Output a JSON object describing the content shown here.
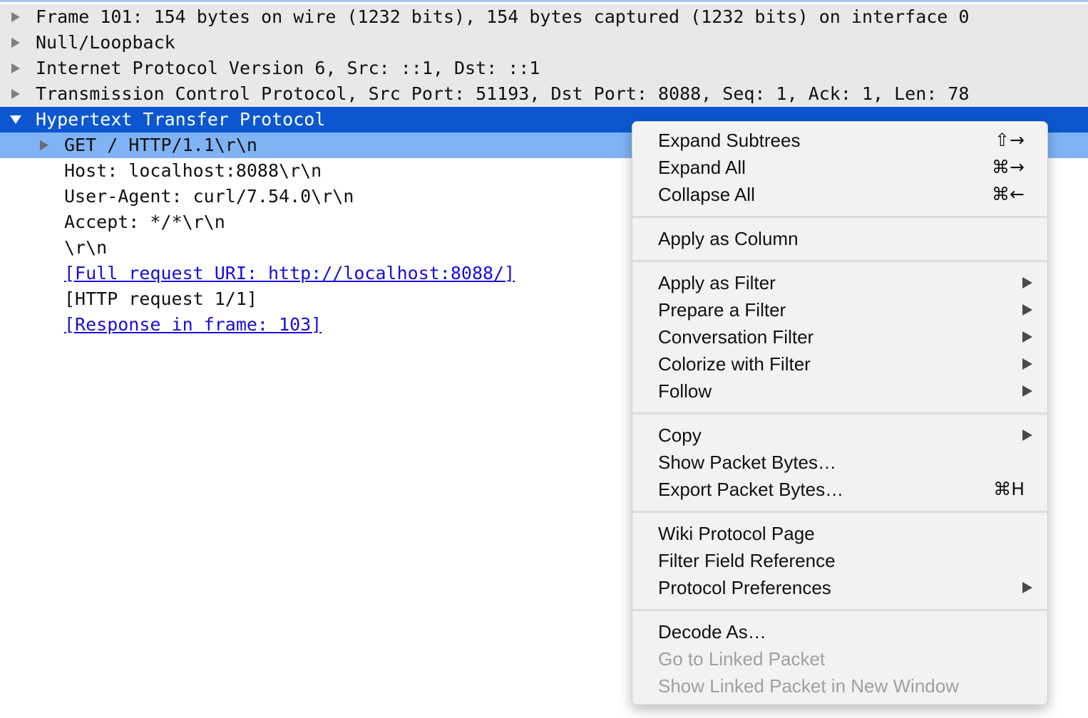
{
  "tree": {
    "rows": [
      {
        "text": "Frame 101: 154 bytes on wire (1232 bits), 154 bytes captured (1232 bits) on interface 0"
      },
      {
        "text": "Null/Loopback"
      },
      {
        "text": "Internet Protocol Version 6, Src: ::1, Dst: ::1"
      },
      {
        "text": "Transmission Control Protocol, Src Port: 51193, Dst Port: 8088, Seq: 1, Ack: 1, Len: 78"
      },
      {
        "text": "Hypertext Transfer Protocol"
      },
      {
        "text": "GET / HTTP/1.1\\r\\n"
      },
      {
        "text": "Host: localhost:8088\\r\\n"
      },
      {
        "text": "User-Agent: curl/7.54.0\\r\\n"
      },
      {
        "text": "Accept: */*\\r\\n"
      },
      {
        "text": "\\r\\n"
      },
      {
        "text": "[Full request URI: http://localhost:8088/]"
      },
      {
        "text": "[HTTP request 1/1]"
      },
      {
        "text": "[Response in frame: 103]"
      }
    ]
  },
  "menu": {
    "items": [
      {
        "label": "Expand Subtrees",
        "shortcut": "⇧→"
      },
      {
        "label": "Expand All",
        "shortcut": "⌘→"
      },
      {
        "label": "Collapse All",
        "shortcut": "⌘←"
      },
      {
        "label": "Apply as Column"
      },
      {
        "label": "Apply as Filter"
      },
      {
        "label": "Prepare a Filter"
      },
      {
        "label": "Conversation Filter"
      },
      {
        "label": "Colorize with Filter"
      },
      {
        "label": "Follow"
      },
      {
        "label": "Copy"
      },
      {
        "label": "Show Packet Bytes…"
      },
      {
        "label": "Export Packet Bytes…",
        "shortcut": "⌘H"
      },
      {
        "label": "Wiki Protocol Page"
      },
      {
        "label": "Filter Field Reference"
      },
      {
        "label": "Protocol Preferences"
      },
      {
        "label": "Decode As…"
      },
      {
        "label": "Go to Linked Packet"
      },
      {
        "label": "Show Linked Packet in New Window"
      }
    ]
  },
  "colors": {
    "selected_row": "#0c57d0",
    "child_highlight": "#7fb3f3",
    "link": "#1a0dd6",
    "disabled_text": "#a0a0a0"
  }
}
